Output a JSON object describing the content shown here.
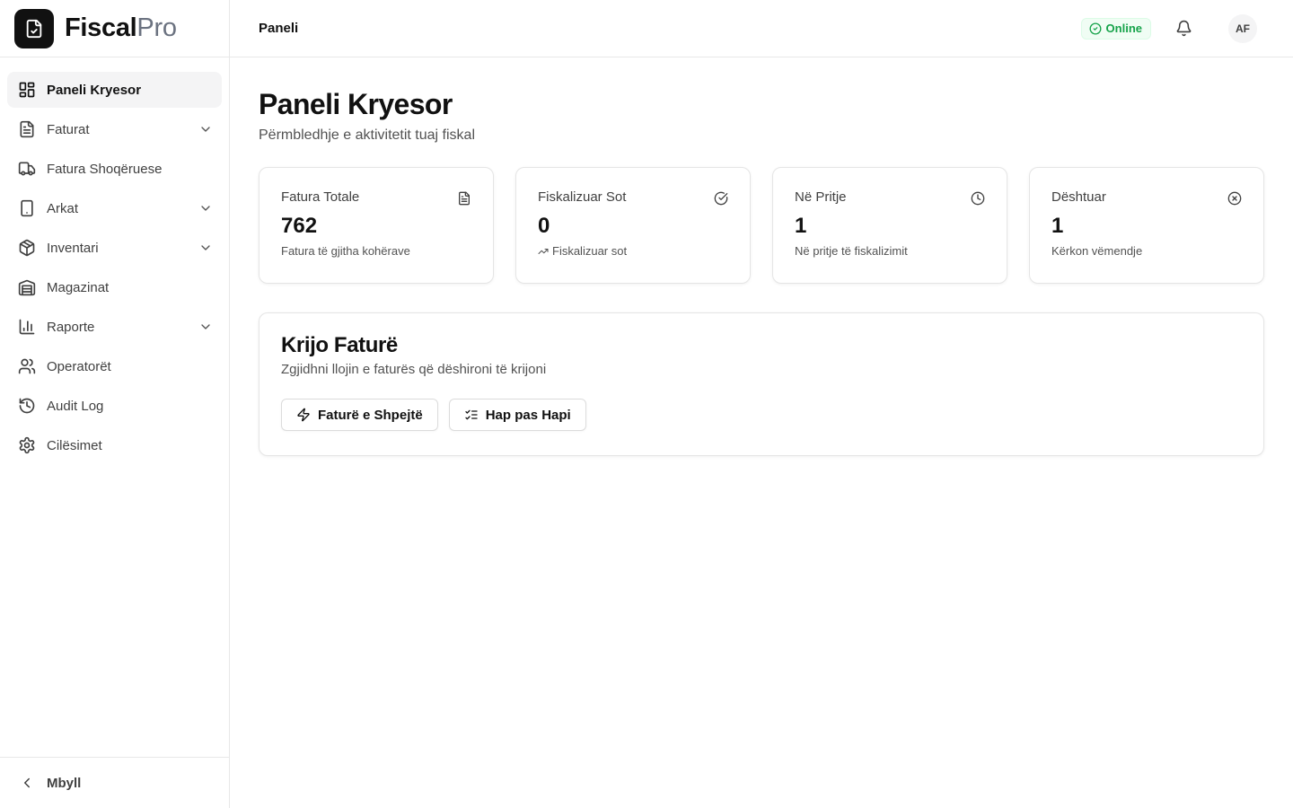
{
  "app": {
    "brand_main": "Fiscal",
    "brand_accent": "Pro",
    "logo_icon": "file-check-icon"
  },
  "sidebar": {
    "items": [
      {
        "label": "Paneli Kryesor",
        "icon": "dashboard-grid-icon",
        "active": true,
        "has_children": false
      },
      {
        "label": "Faturat",
        "icon": "file-text-icon",
        "active": false,
        "has_children": true
      },
      {
        "label": "Fatura Shoqëruese",
        "icon": "truck-icon",
        "active": false,
        "has_children": false
      },
      {
        "label": "Arkat",
        "icon": "tablet-icon",
        "active": false,
        "has_children": true
      },
      {
        "label": "Inventari",
        "icon": "package-icon",
        "active": false,
        "has_children": true
      },
      {
        "label": "Magazinat",
        "icon": "warehouse-icon",
        "active": false,
        "has_children": false
      },
      {
        "label": "Raporte",
        "icon": "bar-chart-icon",
        "active": false,
        "has_children": true
      },
      {
        "label": "Operatorët",
        "icon": "users-icon",
        "active": false,
        "has_children": false
      },
      {
        "label": "Audit Log",
        "icon": "history-icon",
        "active": false,
        "has_children": false
      },
      {
        "label": "Cilësimet",
        "icon": "settings-icon",
        "active": false,
        "has_children": false
      }
    ],
    "collapse_label": "Mbyll"
  },
  "header": {
    "breadcrumb": "Paneli",
    "status": "Online",
    "status_color": "#16a34a",
    "avatar_initials": "AF"
  },
  "main": {
    "title": "Paneli Kryesor",
    "subtitle": "Përmbledhje e aktivitetit tuaj fiskal",
    "stats": [
      {
        "title": "Fatura Totale",
        "value": "762",
        "sub": "Fatura të gjitha kohërave",
        "icon": "file-text-icon"
      },
      {
        "title": "Fiskalizuar Sot",
        "value": "0",
        "sub": "Fiskalizuar sot",
        "icon": "check-circle-icon",
        "sub_icon": "trending-up-icon"
      },
      {
        "title": "Në Pritje",
        "value": "1",
        "sub": "Në pritje të fiskalizimit",
        "icon": "clock-icon"
      },
      {
        "title": "Dështuar",
        "value": "1",
        "sub": "Kërkon vëmendje",
        "icon": "x-circle-icon"
      }
    ],
    "create": {
      "title": "Krijo Faturë",
      "subtitle": "Zgjidhni llojin e faturës që dëshironi të krijoni",
      "quick_label": "Faturë e Shpejtë",
      "stepwise_label": "Hap pas Hapi"
    }
  }
}
